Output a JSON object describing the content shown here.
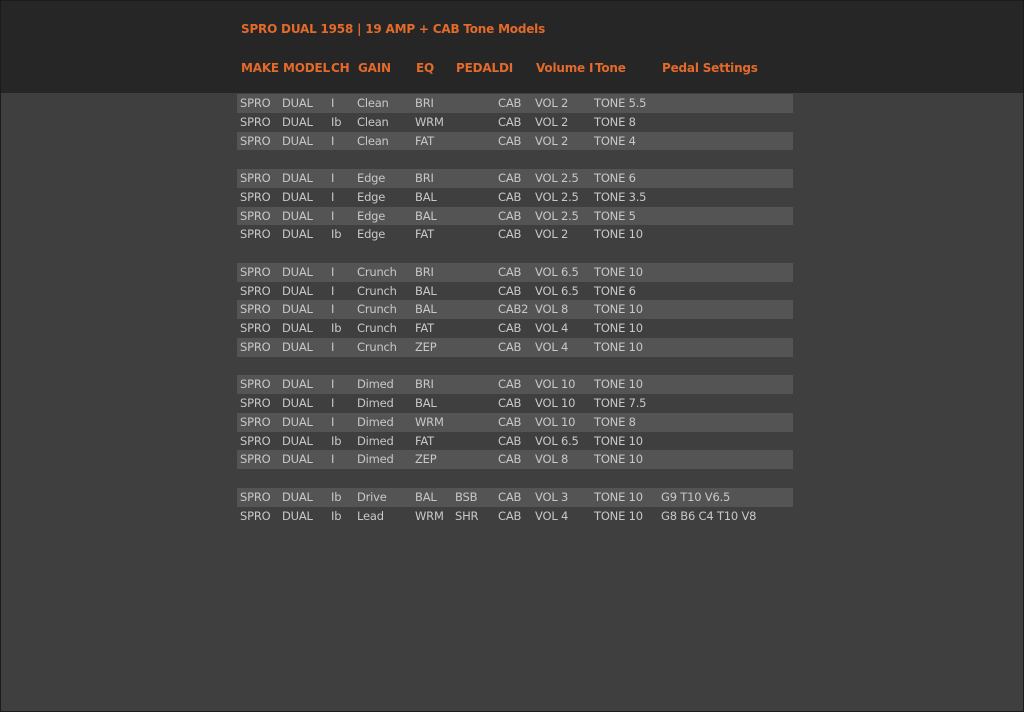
{
  "title": "SPRO DUAL 1958 | 19 AMP + CAB Tone Models",
  "headers": {
    "make": "MAKE",
    "model": "MODEL",
    "ch": "CH",
    "gain": "GAIN",
    "eq": "EQ",
    "pedal": "PEDAL",
    "di": "DI",
    "volume": "Volume I",
    "tone": "Tone",
    "pedal_settings": "Pedal Settings"
  },
  "rows": [
    {
      "shaded": true,
      "make": "SPRO",
      "model": "DUAL",
      "ch": "I",
      "gain": "Clean",
      "eq": "BRI",
      "pedal": "",
      "di": "CAB",
      "volume": "VOL 2",
      "tone": "TONE 5.5",
      "settings": ""
    },
    {
      "shaded": false,
      "make": "SPRO",
      "model": "DUAL",
      "ch": "Ib",
      "gain": "Clean",
      "eq": "WRM",
      "pedal": "",
      "di": "CAB",
      "volume": "VOL 2",
      "tone": "TONE 8",
      "settings": ""
    },
    {
      "shaded": true,
      "make": "SPRO",
      "model": "DUAL",
      "ch": "I",
      "gain": "Clean",
      "eq": "FAT",
      "pedal": "",
      "di": "CAB",
      "volume": "VOL 2",
      "tone": "TONE 4",
      "settings": ""
    },
    {
      "blank": true
    },
    {
      "shaded": true,
      "make": "SPRO",
      "model": "DUAL",
      "ch": "I",
      "gain": "Edge",
      "eq": "BRI",
      "pedal": "",
      "di": "CAB",
      "volume": "VOL 2.5",
      "tone": "TONE 6",
      "settings": ""
    },
    {
      "shaded": false,
      "make": "SPRO",
      "model": "DUAL",
      "ch": "I",
      "gain": "Edge",
      "eq": "BAL",
      "pedal": "",
      "di": "CAB",
      "volume": "VOL 2.5",
      "tone": "TONE 3.5",
      "settings": ""
    },
    {
      "shaded": true,
      "make": "SPRO",
      "model": "DUAL",
      "ch": "I",
      "gain": "Edge",
      "eq": "BAL",
      "pedal": "",
      "di": "CAB",
      "volume": "VOL 2.5",
      "tone": "TONE 5",
      "settings": ""
    },
    {
      "shaded": false,
      "make": "SPRO",
      "model": "DUAL",
      "ch": "Ib",
      "gain": "Edge",
      "eq": "FAT",
      "pedal": "",
      "di": "CAB",
      "volume": "VOL 2",
      "tone": "TONE 10",
      "settings": ""
    },
    {
      "blank": true
    },
    {
      "shaded": true,
      "make": "SPRO",
      "model": "DUAL",
      "ch": "I",
      "gain": "Crunch",
      "eq": "BRI",
      "pedal": "",
      "di": "CAB",
      "volume": "VOL 6.5",
      "tone": "TONE 10",
      "settings": ""
    },
    {
      "shaded": false,
      "make": "SPRO",
      "model": "DUAL",
      "ch": "I",
      "gain": "Crunch",
      "eq": "BAL",
      "pedal": "",
      "di": "CAB",
      "volume": "VOL 6.5",
      "tone": "TONE 6",
      "settings": ""
    },
    {
      "shaded": true,
      "make": "SPRO",
      "model": "DUAL",
      "ch": "I",
      "gain": "Crunch",
      "eq": "BAL",
      "pedal": "",
      "di": "CAB2",
      "volume": "VOL 8",
      "tone": "TONE 10",
      "settings": ""
    },
    {
      "shaded": false,
      "make": "SPRO",
      "model": "DUAL",
      "ch": "Ib",
      "gain": "Crunch",
      "eq": "FAT",
      "pedal": "",
      "di": "CAB",
      "volume": "VOL 4",
      "tone": "TONE 10",
      "settings": ""
    },
    {
      "shaded": true,
      "make": "SPRO",
      "model": "DUAL",
      "ch": "I",
      "gain": "Crunch",
      "eq": "ZEP",
      "pedal": "",
      "di": "CAB",
      "volume": "VOL 4",
      "tone": "TONE 10",
      "settings": ""
    },
    {
      "blank": true
    },
    {
      "shaded": true,
      "make": "SPRO",
      "model": "DUAL",
      "ch": "I",
      "gain": "Dimed",
      "eq": "BRI",
      "pedal": "",
      "di": "CAB",
      "volume": "VOL 10",
      "tone": "TONE 10",
      "settings": ""
    },
    {
      "shaded": false,
      "make": "SPRO",
      "model": "DUAL",
      "ch": "I",
      "gain": "Dimed",
      "eq": "BAL",
      "pedal": "",
      "di": "CAB",
      "volume": "VOL 10",
      "tone": "TONE 7.5",
      "settings": ""
    },
    {
      "shaded": true,
      "make": "SPRO",
      "model": "DUAL",
      "ch": "I",
      "gain": "Dimed",
      "eq": "WRM",
      "pedal": "",
      "di": "CAB",
      "volume": "VOL 10",
      "tone": "TONE 8",
      "settings": ""
    },
    {
      "shaded": false,
      "make": "SPRO",
      "model": "DUAL",
      "ch": "Ib",
      "gain": "Dimed",
      "eq": "FAT",
      "pedal": "",
      "di": "CAB",
      "volume": "VOL 6.5",
      "tone": "TONE 10",
      "settings": ""
    },
    {
      "shaded": true,
      "make": "SPRO",
      "model": "DUAL",
      "ch": "I",
      "gain": "Dimed",
      "eq": "ZEP",
      "pedal": "",
      "di": "CAB",
      "volume": "VOL 8",
      "tone": "TONE 10",
      "settings": ""
    },
    {
      "blank": true
    },
    {
      "shaded": true,
      "make": "SPRO",
      "model": "DUAL",
      "ch": "Ib",
      "gain": "Drive",
      "eq": "BAL",
      "pedal": "BSB",
      "di": "CAB",
      "volume": "VOL 3",
      "tone": "TONE 10",
      "settings": "G9 T10 V6.5"
    },
    {
      "shaded": false,
      "make": "SPRO",
      "model": "DUAL",
      "ch": "Ib",
      "gain": "Lead",
      "eq": "WRM",
      "pedal": "SHR",
      "di": "CAB",
      "volume": "VOL 4",
      "tone": "TONE 10",
      "settings": "G8 B6 C4 T10 V8"
    }
  ]
}
